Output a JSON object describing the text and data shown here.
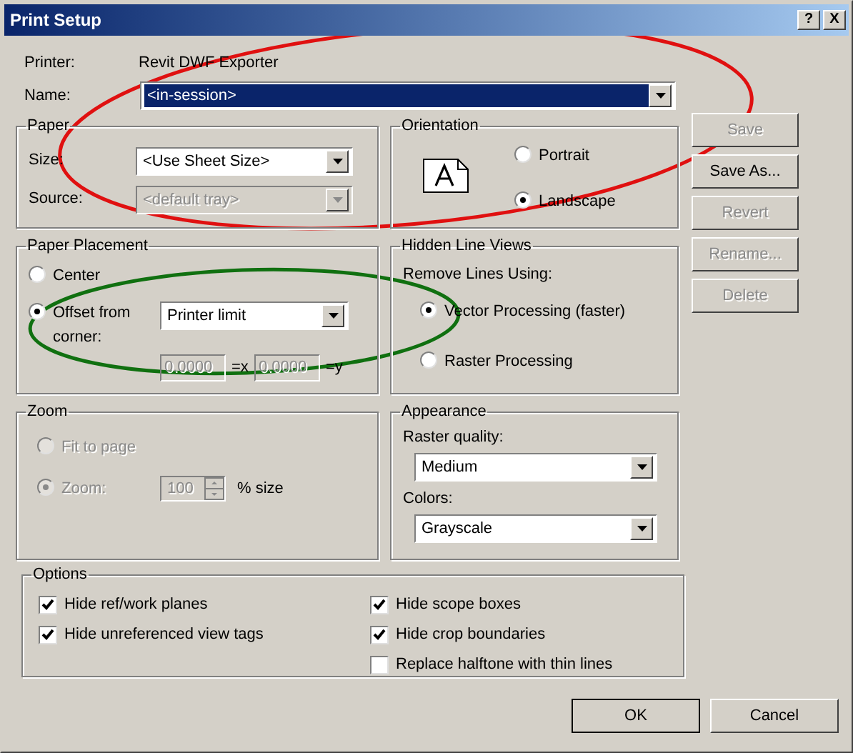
{
  "window": {
    "title": "Print Setup",
    "help_button": "?",
    "close_button": "X"
  },
  "printer": {
    "label": "Printer:",
    "value": "Revit DWF Exporter"
  },
  "name": {
    "label": "Name:",
    "value": "<in-session>"
  },
  "paper": {
    "title": "Paper",
    "fields": [
      {
        "label": "Size:",
        "value": "<Use Sheet Size>",
        "disabled": false
      },
      {
        "label": "Source:",
        "value": "<default tray>",
        "disabled": true
      }
    ]
  },
  "orientation": {
    "title": "Orientation",
    "options": [
      {
        "label": "Portrait",
        "selected": false
      },
      {
        "label": "Landscape",
        "selected": true
      }
    ]
  },
  "paper_placement": {
    "title": "Paper Placement",
    "options": [
      {
        "label": "Center",
        "selected": false
      },
      {
        "label": "Offset from corner:",
        "selected": true
      }
    ],
    "offset": "Printer limit",
    "x_value": "0.0000",
    "x_label": "=x",
    "y_value": "0.0000",
    "y_label": "=y"
  },
  "hidden_line_views": {
    "title": "Hidden Line Views",
    "subtitle": "Remove Lines Using:",
    "options": [
      {
        "label": "Vector Processing (faster)",
        "selected": true
      },
      {
        "label": "Raster Processing",
        "selected": false
      }
    ]
  },
  "zoom": {
    "title": "Zoom",
    "options": [
      {
        "label": "Fit to page",
        "selected": false,
        "disabled": true
      },
      {
        "label": "Zoom:",
        "selected": true,
        "disabled": true
      }
    ],
    "value": "100",
    "suffix": "% size"
  },
  "appearance": {
    "title": "Appearance",
    "fields": [
      {
        "label": "Raster quality:",
        "value": "Medium"
      },
      {
        "label": "Colors:",
        "value": "Grayscale"
      }
    ]
  },
  "options": {
    "title": "Options",
    "left": [
      {
        "label": "Hide ref/work planes",
        "checked": true
      },
      {
        "label": "Hide unreferenced view tags",
        "checked": true
      }
    ],
    "right": [
      {
        "label": "Hide scope boxes",
        "checked": true
      },
      {
        "label": "Hide crop boundaries",
        "checked": true
      },
      {
        "label": "Replace halftone with thin lines",
        "checked": false
      }
    ]
  },
  "side_buttons": [
    {
      "label": "Save",
      "disabled": true
    },
    {
      "label": "Save As...",
      "disabled": false
    },
    {
      "label": "Revert",
      "disabled": true
    },
    {
      "label": "Rename...",
      "disabled": true
    },
    {
      "label": "Delete",
      "disabled": true
    }
  ],
  "footer_buttons": [
    {
      "label": "OK",
      "default": true
    },
    {
      "label": "Cancel",
      "default": false
    }
  ],
  "annotations": [
    {
      "color": "#e01010"
    },
    {
      "color": "#107010"
    }
  ]
}
